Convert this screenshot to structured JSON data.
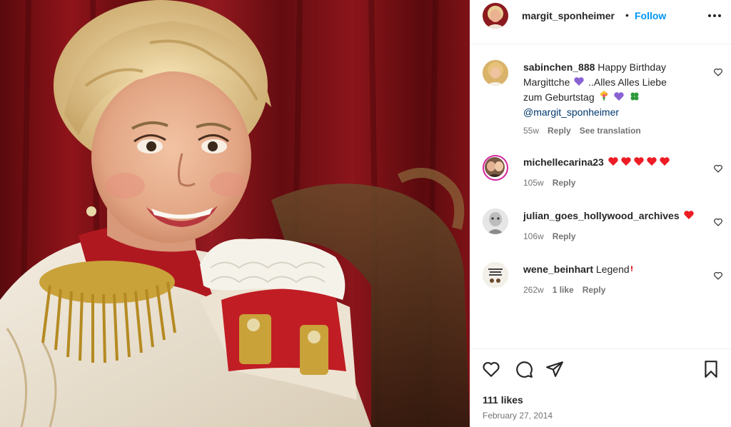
{
  "post": {
    "author": "margit_sponheimer",
    "separator": "•",
    "follow_label": "Follow",
    "more_icon": "more-horizontal-icon",
    "likes": "111 likes",
    "date": "February 27, 2014"
  },
  "comments": [
    {
      "user": "sabinchen_888",
      "text_1": "Happy Birthday",
      "text_2": "Margittche",
      "text_3": "..Alles Alles Liebe",
      "text_4": "zum Geburtstag",
      "mention": "@margit_sponheimer",
      "time": "55w",
      "reply": "Reply",
      "translate": "See translation"
    },
    {
      "user": "michellecarina23",
      "time": "105w",
      "reply": "Reply"
    },
    {
      "user": "julian_goes_hollywood_archives",
      "time": "106w",
      "reply": "Reply"
    },
    {
      "user": "wene_beinhart",
      "text": "Legend",
      "time": "262w",
      "likes": "1 like",
      "reply": "Reply"
    }
  ],
  "actions": {
    "like_icon": "heart-icon",
    "comment_icon": "comment-icon",
    "share_icon": "share-icon",
    "save_icon": "bookmark-icon"
  },
  "colors": {
    "follow": "#0095f6",
    "mention": "#00376b",
    "meta": "#737373",
    "heart_red": "#ed1c24",
    "purple_heart": "#8a63d2"
  }
}
